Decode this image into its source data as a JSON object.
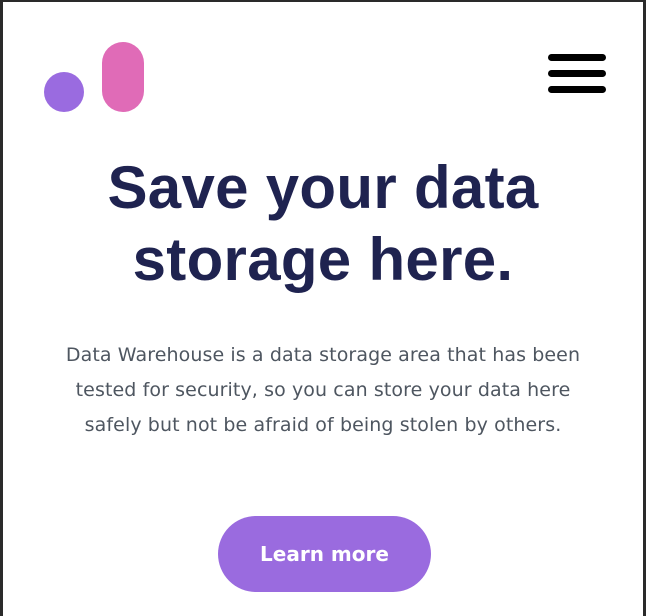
{
  "colors": {
    "dot": "#9a6be0",
    "pill": "#e06bb7",
    "headline": "#1f2350",
    "body_text": "#4e5660",
    "cta_bg": "#9a6bdf",
    "cta_text": "#ffffff",
    "menu_icon": "#000000"
  },
  "header": {
    "logo_icon": "logo-dot-and-pill",
    "menu_icon": "hamburger-menu-icon"
  },
  "hero": {
    "headline_lines": [
      "Save your data",
      "storage here."
    ],
    "description_lines": [
      "Data Warehouse is a data storage area that has been",
      "tested for security, so you can store your data here",
      "safely but not be afraid of being stolen by others."
    ],
    "cta_label": "Learn more"
  }
}
